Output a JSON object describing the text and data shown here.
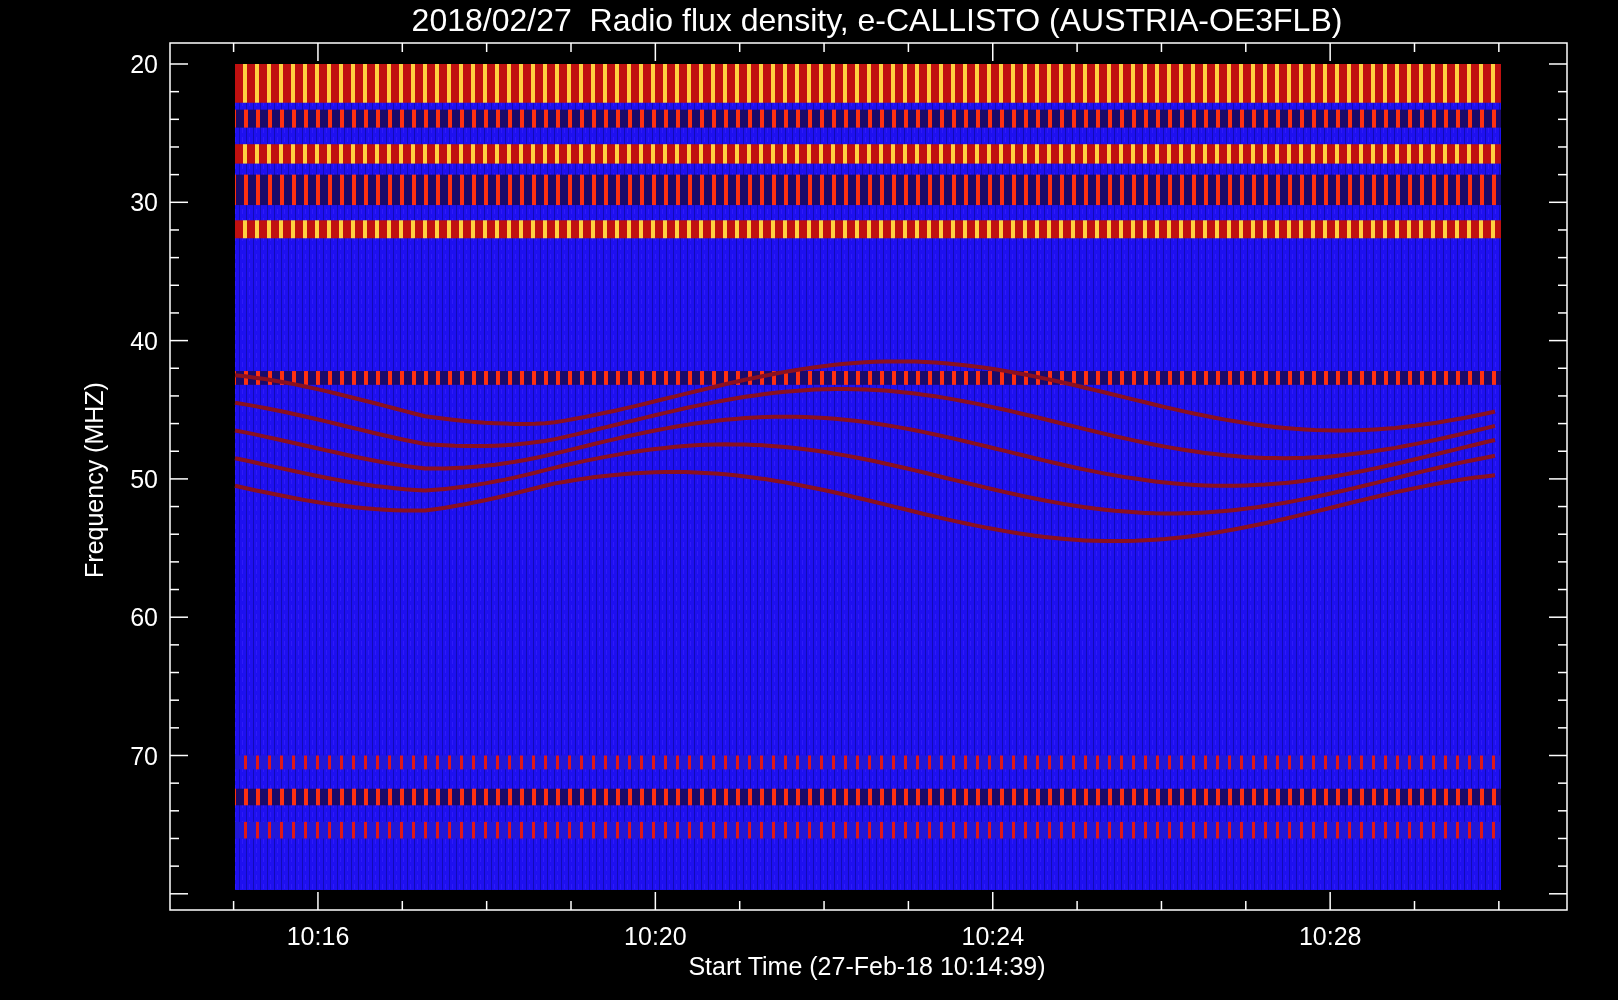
{
  "title": "2018/02/27  Radio flux density, e-CALLISTO (AUSTRIA-OE3FLB)",
  "ylabel": "Frequency (MHZ)",
  "xlabel": "Start Time (27-Feb-18 10:14:39)",
  "yticks": [
    "20",
    "30",
    "40",
    "50",
    "60",
    "70"
  ],
  "xticks": [
    "10:16",
    "10:20",
    "10:24",
    "10:28"
  ]
}
